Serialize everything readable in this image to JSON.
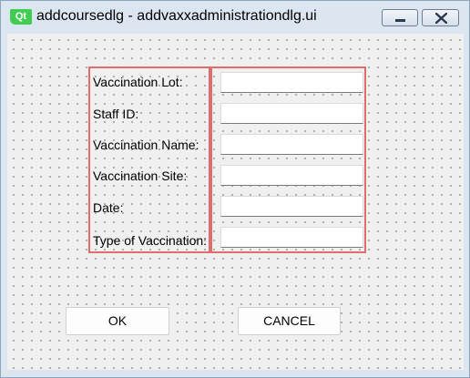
{
  "window": {
    "logo_text": "Qt",
    "title": "addcoursedlg - addvaxxadministrationdlg.ui"
  },
  "icons": {
    "app": "qt-logo-icon",
    "minimize": "minimize-icon",
    "close": "close-icon"
  },
  "form": {
    "labels": [
      "Vaccination Lot:",
      "Staff ID:",
      "Vaccination Name:",
      "Vaccination Site:",
      "Date:",
      "Type of Vaccination:"
    ],
    "values": [
      "",
      "",
      "",
      "",
      "",
      ""
    ]
  },
  "buttons": {
    "ok_label": "OK",
    "cancel_label": "CANCEL"
  },
  "colors": {
    "layout_outline": "#e06c6c",
    "qt_green": "#41cd52"
  }
}
